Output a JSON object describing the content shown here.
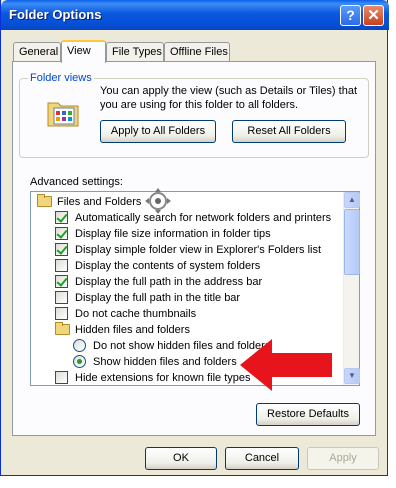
{
  "window": {
    "title": "Folder Options",
    "help_glyph": "?",
    "close_glyph": "✕"
  },
  "tabs": [
    {
      "label": "General",
      "active": false
    },
    {
      "label": "View",
      "active": true
    },
    {
      "label": "File Types",
      "active": false
    },
    {
      "label": "Offline Files",
      "active": false
    }
  ],
  "folder_views": {
    "label": "Folder views",
    "description": "You can apply the view (such as Details or Tiles) that you are using for this folder to all folders.",
    "apply_button": "Apply to All Folders",
    "reset_button": "Reset All Folders"
  },
  "advanced": {
    "label": "Advanced settings:",
    "items": [
      {
        "kind": "folder",
        "label": "Files and Folders"
      },
      {
        "kind": "checkbox",
        "checked": true,
        "label": "Automatically search for network folders and printers"
      },
      {
        "kind": "checkbox",
        "checked": true,
        "label": "Display file size information in folder tips"
      },
      {
        "kind": "checkbox",
        "checked": true,
        "label": "Display simple folder view in Explorer's Folders list"
      },
      {
        "kind": "checkbox",
        "checked": false,
        "label": "Display the contents of system folders"
      },
      {
        "kind": "checkbox",
        "checked": true,
        "label": "Display the full path in the address bar"
      },
      {
        "kind": "checkbox",
        "checked": false,
        "label": "Display the full path in the title bar"
      },
      {
        "kind": "checkbox",
        "checked": false,
        "label": "Do not cache thumbnails"
      },
      {
        "kind": "folder",
        "label": "Hidden files and folders"
      },
      {
        "kind": "radio",
        "checked": false,
        "label": "Do not show hidden files and folders"
      },
      {
        "kind": "radio",
        "checked": true,
        "label": "Show hidden files and folders"
      },
      {
        "kind": "checkbox",
        "checked": false,
        "label": "Hide extensions for known file types"
      }
    ],
    "scroll_up_glyph": "▲",
    "scroll_down_glyph": "▼"
  },
  "restore_button": "Restore Defaults",
  "footer": {
    "ok": "OK",
    "cancel": "Cancel",
    "apply": "Apply"
  },
  "colors": {
    "titlebar": "#0a58de",
    "dialog_bg": "#ece9d8",
    "group_label": "#0046d5",
    "annotation_arrow": "#e8141b",
    "check_mark": "#21a121"
  }
}
